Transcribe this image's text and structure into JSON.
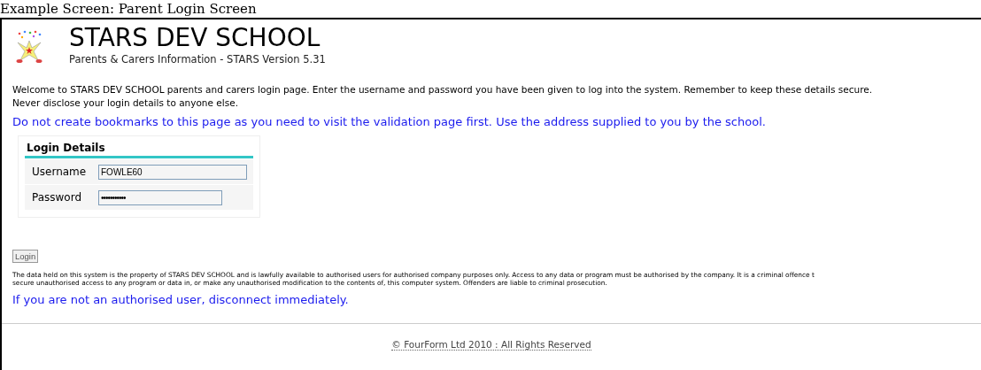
{
  "document_caption": "Example Screen: Parent Login Screen",
  "header": {
    "title": "STARS DEV SCHOOL",
    "subtitle": "Parents & Carers Information - STARS Version 5.31"
  },
  "welcome_lines": [
    "Welcome to STARS DEV SCHOOL parents and carers login page. Enter the username and password you have been given to log into the system. Remember to keep these details secure.",
    "Never disclose your login details to anyone else."
  ],
  "bookmark_notice": "Do not create bookmarks to this page as you need to visit the validation page first. Use the address supplied to you by the school.",
  "login_box": {
    "title": "Login Details",
    "fields": [
      {
        "label": "Username",
        "value": "FOWLE60",
        "kind": "text"
      },
      {
        "label": "Password",
        "value": "•••••••••••",
        "kind": "password"
      }
    ]
  },
  "login_button": "Login",
  "disclaimer_lines": [
    "The data held on this system is the property of STARS DEV SCHOOL and is lawfully available to authorised users for authorised company purposes only. Access to any data or program must be authorised by the company. It is a criminal offence t",
    "secure unauthorised access to any program or data in, or make any unauthorised modification to the contents of, this computer system. Offenders are liable to criminal prosecution."
  ],
  "warning": "If you are not an authorised user, disconnect immediately.",
  "footer": "© FourForm Ltd 2010 : All Rights Reserved"
}
